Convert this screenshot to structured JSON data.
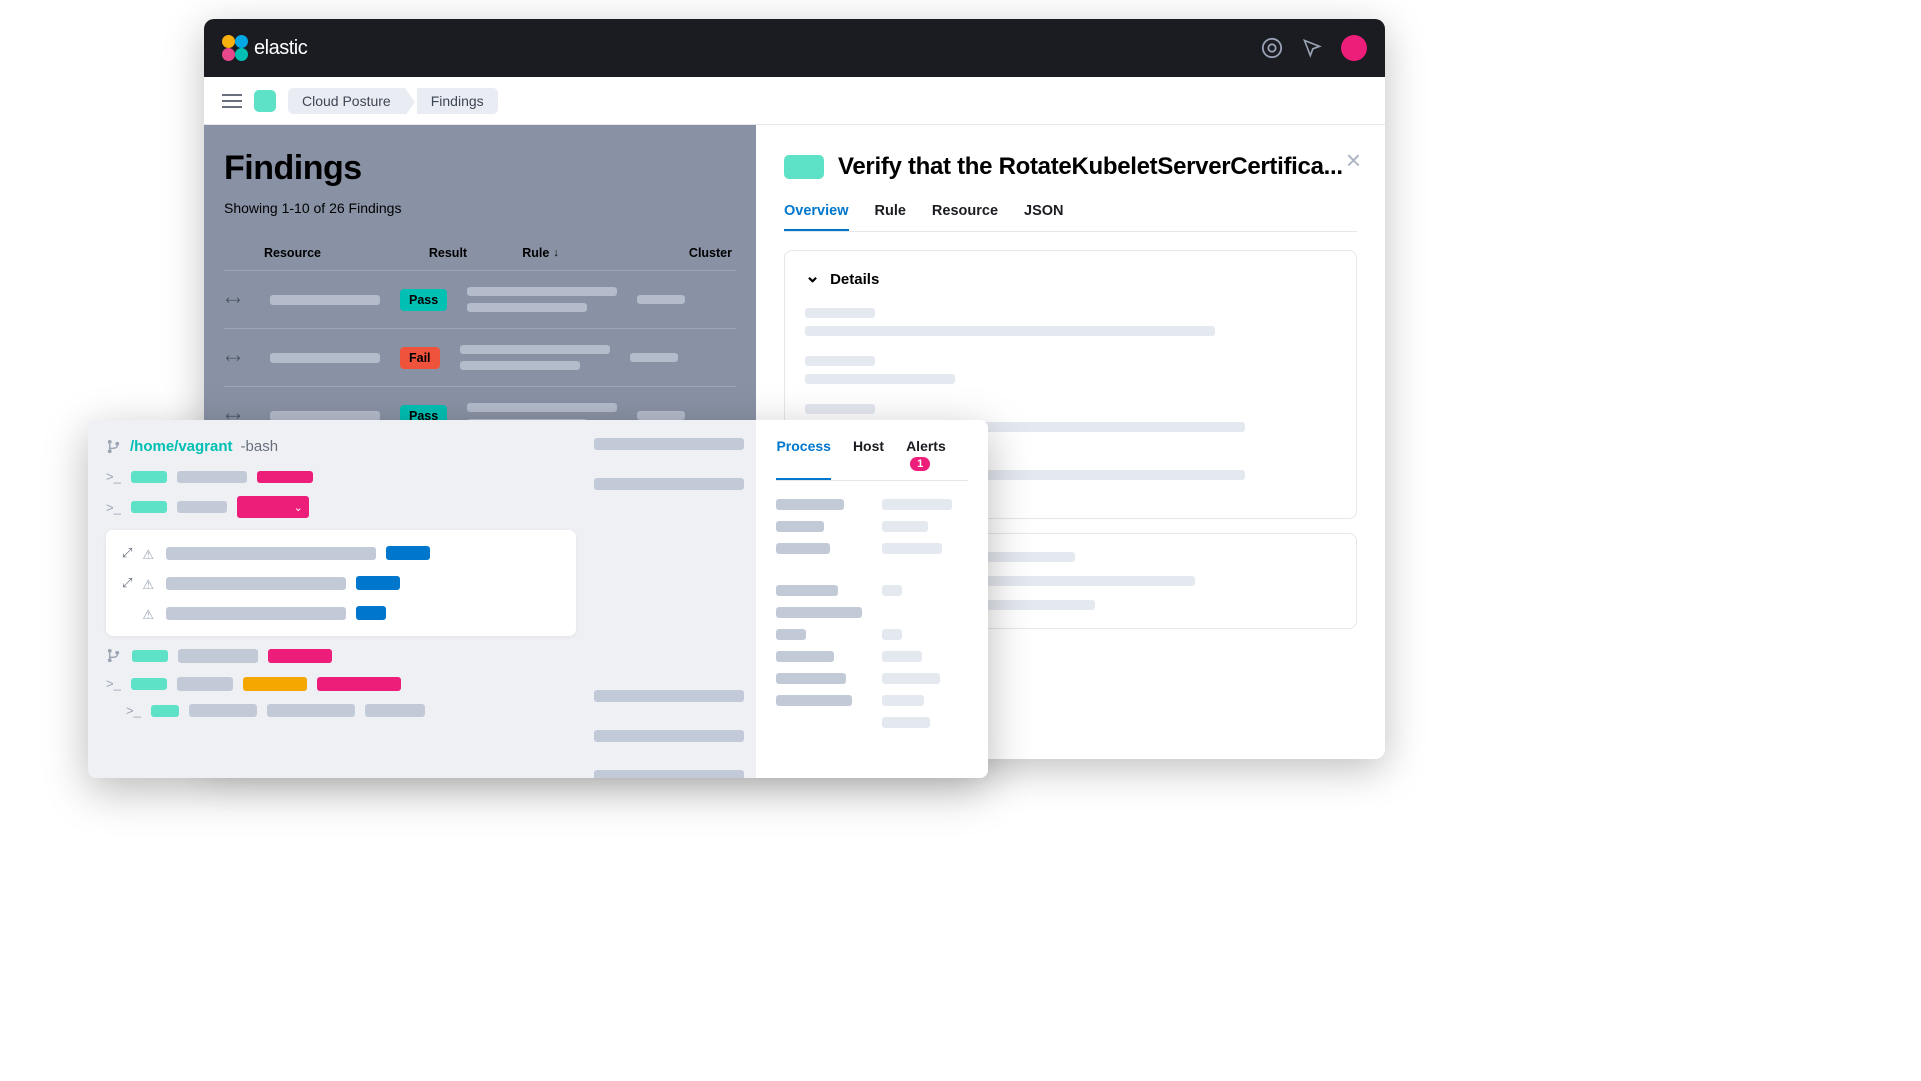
{
  "brand": {
    "name": "elastic"
  },
  "breadcrumb": {
    "items": [
      "Cloud Posture",
      "Findings"
    ]
  },
  "findings": {
    "title": "Findings",
    "subtitle": "Showing 1-10 of 26 Findings",
    "columns": {
      "resource": "Resource",
      "result": "Result",
      "rule": "Rule",
      "cluster": "Cluster"
    },
    "rows": [
      {
        "result": "Pass",
        "result_class": "pass"
      },
      {
        "result": "Fail",
        "result_class": "fail"
      },
      {
        "result": "Pass",
        "result_class": "pass"
      }
    ]
  },
  "detail": {
    "title": "Verify that the RotateKubeletServerCertifica...",
    "tabs": [
      "Overview",
      "Rule",
      "Resource",
      "JSON"
    ],
    "active_tab": "Overview",
    "section_title": "Details"
  },
  "overlay": {
    "path": "/home/vagrant",
    "shell": "-bash",
    "right_tabs": {
      "process": "Process",
      "host": "Host",
      "alerts": "Alerts",
      "alerts_count": "1",
      "active": "Process"
    }
  },
  "colors": {
    "teal": "#5de2c7",
    "pink": "#ed1e79",
    "blue": "#0077cc",
    "yellow": "#f5a700",
    "pass": "#00bfb3",
    "fail": "#f0533c"
  }
}
